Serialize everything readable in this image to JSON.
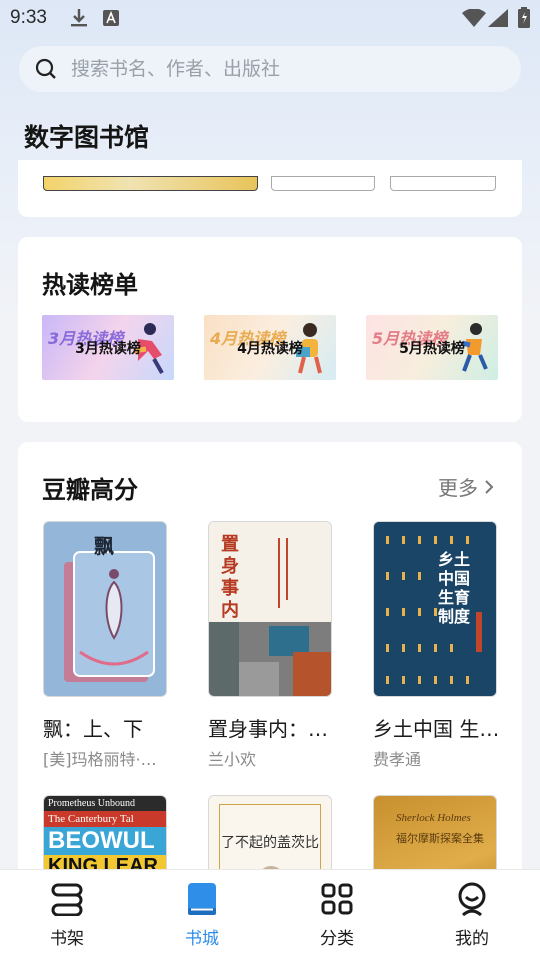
{
  "status_bar": {
    "time": "9:33",
    "icons": [
      "download-icon",
      "a-icon",
      "wifi-icon",
      "signal-icon",
      "battery-icon"
    ]
  },
  "search": {
    "placeholder": "搜索书名、作者、出版社"
  },
  "header": {
    "title": "数字图书馆"
  },
  "hot_list": {
    "title": "热读榜单",
    "banners": [
      {
        "label": "3月热读榜",
        "bg_text": "3月热读榜",
        "accent": "#7b5cd6"
      },
      {
        "label": "4月热读榜",
        "bg_text": "4月热读榜",
        "accent": "#e6a23c"
      },
      {
        "label": "5月热读榜",
        "bg_text": "5月热读榜",
        "accent": "#e06a7a"
      }
    ]
  },
  "douban": {
    "title": "豆瓣高分",
    "more_label": "更多",
    "books": [
      {
        "title": "飘：上、下",
        "author": "[美]玛格丽特·…",
        "cover_title": "飘"
      },
      {
        "title": "置身事内：…",
        "author": "兰小欢",
        "cover_title": "置身事内"
      },
      {
        "title": "乡土中国 生…",
        "author": "费孝通",
        "cover_title": "乡土中国 生育制度"
      }
    ],
    "next_covers": [
      {
        "lines": [
          "Prometheus Unbound",
          "The Canterbury Tal",
          "BEOWUL",
          "KING LEAR"
        ]
      },
      {
        "title": "了不起的盖茨比"
      },
      {
        "title": "福尔摩斯探案全集",
        "subtitle": "Sherlock Holmes"
      }
    ]
  },
  "bottom_nav": [
    {
      "label": "书架",
      "icon": "bookshelf-icon",
      "active": false
    },
    {
      "label": "书城",
      "icon": "book-icon",
      "active": true
    },
    {
      "label": "分类",
      "icon": "grid-icon",
      "active": false
    },
    {
      "label": "我的",
      "icon": "profile-icon",
      "active": false
    }
  ],
  "colors": {
    "accent": "#2f8ee8",
    "background": "#f2f3f6"
  }
}
